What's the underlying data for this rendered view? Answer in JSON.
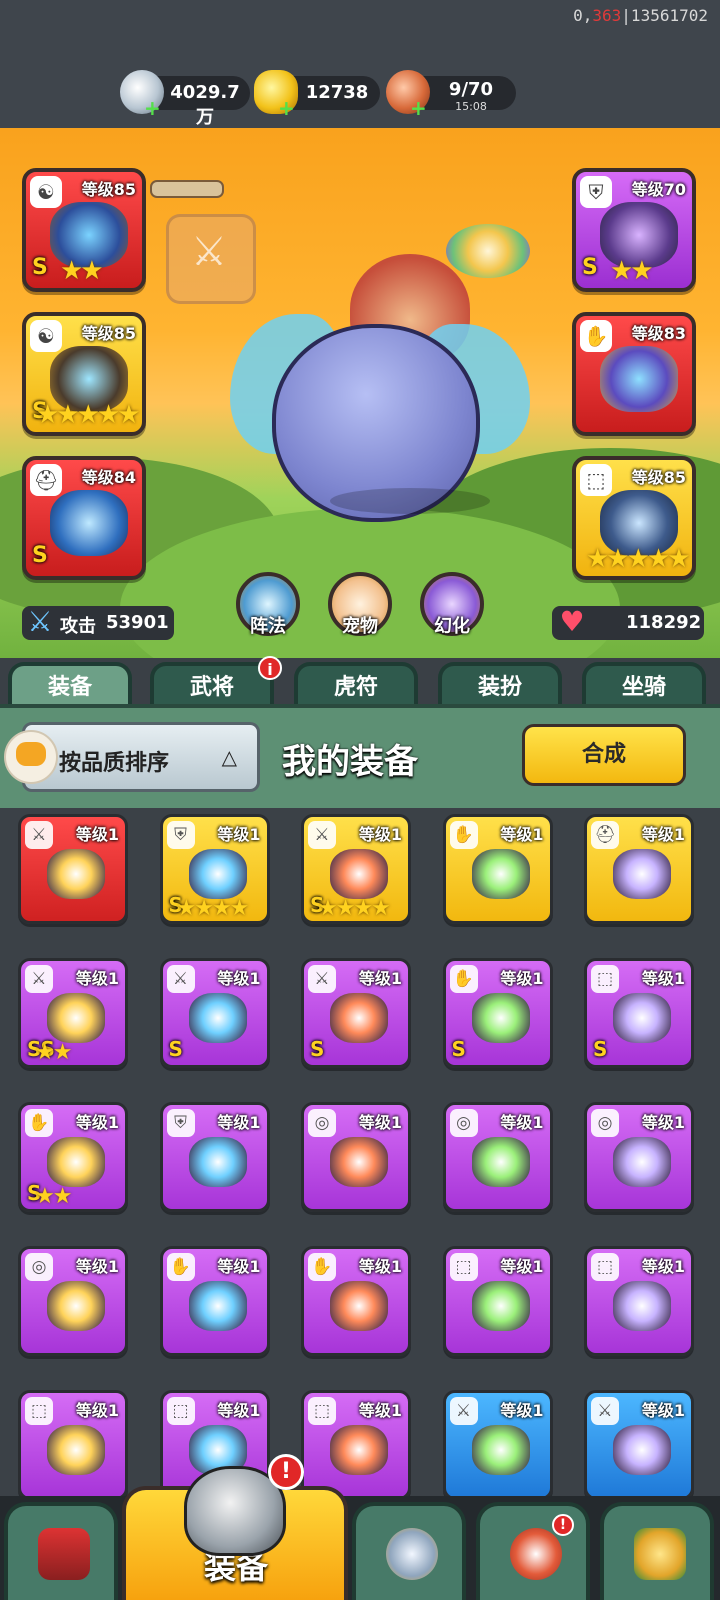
{
  "debug": {
    "prefix": "0,",
    "highlight": "363",
    "suffix": "|13561702"
  },
  "resources": [
    {
      "name": "silver",
      "value": "4029.7万"
    },
    {
      "name": "gold-ingot",
      "value": "12738"
    },
    {
      "name": "stamina",
      "value": "9/70",
      "timer": "15:08"
    }
  ],
  "hero_slots": {
    "left": [
      {
        "level": "等级85",
        "color": "red",
        "badge": "☯",
        "rank": "S",
        "stars": "★★"
      },
      {
        "level": "等级85",
        "color": "gold",
        "badge": "☯",
        "rank": "S",
        "stars": "★★★★★"
      },
      {
        "level": "等级84",
        "color": "red",
        "badge": "⛑",
        "rank": "S",
        "stars": ""
      }
    ],
    "right": [
      {
        "level": "等级70",
        "color": "purple",
        "badge": "⛨",
        "rank": "S",
        "stars": "★★"
      },
      {
        "level": "等级83",
        "color": "red",
        "badge": "✋",
        "rank": "",
        "stars": ""
      },
      {
        "level": "等级85",
        "color": "gold",
        "badge": "⬚",
        "rank": "",
        "stars": "★★★★★"
      }
    ]
  },
  "scene_buttons": [
    {
      "label": "阵法",
      "icon": "formation-icon"
    },
    {
      "label": "宠物",
      "icon": "pet-icon"
    },
    {
      "label": "幻化",
      "icon": "transform-icon"
    }
  ],
  "stats": {
    "attack_label": "攻击",
    "attack": "53901",
    "hp": "118292"
  },
  "tabs": [
    "装备",
    "武将",
    "虎符",
    "装扮",
    "坐骑"
  ],
  "tab_alert": "i",
  "header": {
    "sort_label": "按品质排序",
    "title": "我的装备",
    "compose": "合成"
  },
  "grid_items": [
    {
      "level": "等级1",
      "color": "red",
      "badge": "⚔",
      "rank": "",
      "stars": ""
    },
    {
      "level": "等级1",
      "color": "gold",
      "badge": "⛨",
      "rank": "S",
      "stars": "★★★★"
    },
    {
      "level": "等级1",
      "color": "gold",
      "badge": "⚔",
      "rank": "S",
      "stars": "★★★★"
    },
    {
      "level": "等级1",
      "color": "gold",
      "badge": "✋",
      "rank": "",
      "stars": ""
    },
    {
      "level": "等级1",
      "color": "gold",
      "badge": "⛑",
      "rank": "",
      "stars": ""
    },
    {
      "level": "等级1",
      "color": "purple",
      "badge": "⚔",
      "rank": "SS",
      "stars": "★★"
    },
    {
      "level": "等级1",
      "color": "purple",
      "badge": "⚔",
      "rank": "S",
      "stars": ""
    },
    {
      "level": "等级1",
      "color": "purple",
      "badge": "⚔",
      "rank": "S",
      "stars": ""
    },
    {
      "level": "等级1",
      "color": "purple",
      "badge": "✋",
      "rank": "S",
      "stars": ""
    },
    {
      "level": "等级1",
      "color": "purple",
      "badge": "⬚",
      "rank": "S",
      "stars": ""
    },
    {
      "level": "等级1",
      "color": "purple",
      "badge": "✋",
      "rank": "S",
      "stars": "★★"
    },
    {
      "level": "等级1",
      "color": "purple",
      "badge": "⛨",
      "rank": "",
      "stars": ""
    },
    {
      "level": "等级1",
      "color": "purple",
      "badge": "◎",
      "rank": "",
      "stars": ""
    },
    {
      "level": "等级1",
      "color": "purple",
      "badge": "◎",
      "rank": "",
      "stars": ""
    },
    {
      "level": "等级1",
      "color": "purple",
      "badge": "◎",
      "rank": "",
      "stars": ""
    },
    {
      "level": "等级1",
      "color": "purple",
      "badge": "◎",
      "rank": "",
      "stars": ""
    },
    {
      "level": "等级1",
      "color": "purple",
      "badge": "✋",
      "rank": "",
      "stars": ""
    },
    {
      "level": "等级1",
      "color": "purple",
      "badge": "✋",
      "rank": "",
      "stars": ""
    },
    {
      "level": "等级1",
      "color": "purple",
      "badge": "⬚",
      "rank": "",
      "stars": ""
    },
    {
      "level": "等级1",
      "color": "purple",
      "badge": "⬚",
      "rank": "",
      "stars": ""
    },
    {
      "level": "等级1",
      "color": "purple",
      "badge": "⬚",
      "rank": "",
      "stars": ""
    },
    {
      "level": "等级1",
      "color": "purple",
      "badge": "⬚",
      "rank": "",
      "stars": ""
    },
    {
      "level": "等级1",
      "color": "purple",
      "badge": "⬚",
      "rank": "",
      "stars": ""
    },
    {
      "level": "等级1",
      "color": "blue",
      "badge": "⚔",
      "rank": "",
      "stars": ""
    },
    {
      "level": "等级1",
      "color": "blue",
      "badge": "⚔",
      "rank": "",
      "stars": ""
    }
  ],
  "bottom_nav": {
    "active_label": "装备",
    "alert": "!"
  }
}
